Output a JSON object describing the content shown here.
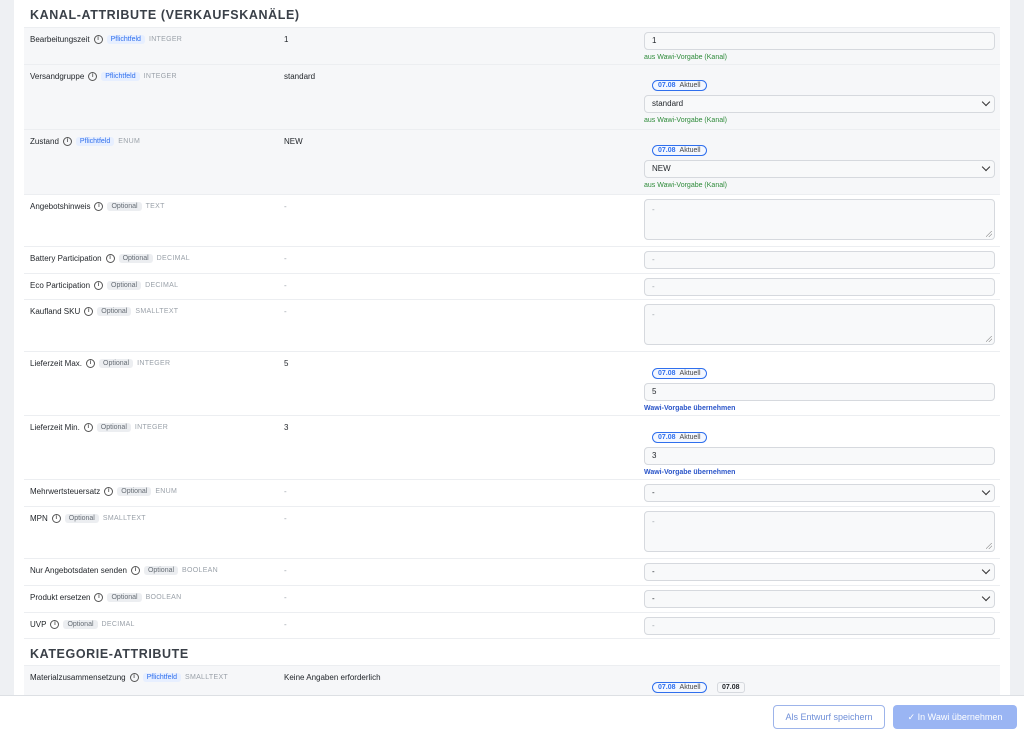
{
  "sections": {
    "kanal_title": "KANAL-ATTRIBUTE (VERKAUFSKANÄLE)",
    "kategorie_title": "KATEGORIE-ATTRIBUTE"
  },
  "badges": {
    "required": "Pflichtfeld",
    "optional": "Optional"
  },
  "version": {
    "number": "07.08",
    "current": "Aktuell",
    "plain": "07.08"
  },
  "hints": {
    "wawi_default_channel": "aus Wawi-Vorgabe (Kanal)",
    "apply_wawi_default": "Wawi-Vorgabe übernehmen"
  },
  "rows": [
    {
      "label": "Bearbeitungszeit",
      "badge": "Pflichtfeld",
      "type": "INTEGER",
      "value": "1",
      "input": "1",
      "hint": "aus Wawi-Vorgabe (Kanal)"
    },
    {
      "label": "Versandgruppe",
      "badge": "Pflichtfeld",
      "type": "INTEGER",
      "value": "standard",
      "select": "standard",
      "hint": "aus Wawi-Vorgabe (Kanal)"
    },
    {
      "label": "Zustand",
      "badge": "Pflichtfeld",
      "type": "ENUM",
      "value": "NEW",
      "select": "NEW",
      "hint": "aus Wawi-Vorgabe (Kanal)"
    },
    {
      "label": "Angebotshinweis",
      "badge": "Optional",
      "type": "TEXT",
      "value": "-",
      "textarea": "-"
    },
    {
      "label": "Battery Participation",
      "badge": "Optional",
      "type": "DECIMAL",
      "value": "-",
      "input": "-"
    },
    {
      "label": "Eco Participation",
      "badge": "Optional",
      "type": "DECIMAL",
      "value": "-",
      "input": "-"
    },
    {
      "label": "Kaufland SKU",
      "badge": "Optional",
      "type": "SMALLTEXT",
      "value": "-",
      "textarea": "-"
    },
    {
      "label": "Lieferzeit Max.",
      "badge": "Optional",
      "type": "INTEGER",
      "value": "5",
      "input": "5",
      "hint": "Wawi-Vorgabe übernehmen"
    },
    {
      "label": "Lieferzeit Min.",
      "badge": "Optional",
      "type": "INTEGER",
      "value": "3",
      "input": "3",
      "hint": "Wawi-Vorgabe übernehmen"
    },
    {
      "label": "Mehrwertsteuersatz",
      "badge": "Optional",
      "type": "ENUM",
      "value": "-",
      "select": "-"
    },
    {
      "label": "MPN",
      "badge": "Optional",
      "type": "SMALLTEXT",
      "value": "-",
      "textarea": "-"
    },
    {
      "label": "Nur Angebotsdaten senden",
      "badge": "Optional",
      "type": "BOOLEAN",
      "value": "-",
      "select": "-"
    },
    {
      "label": "Produkt ersetzen",
      "badge": "Optional",
      "type": "BOOLEAN",
      "value": "-",
      "select": "-"
    },
    {
      "label": "UVP",
      "badge": "Optional",
      "type": "DECIMAL",
      "value": "-",
      "input": "-"
    },
    {
      "label": "Materialzusammensetzung",
      "badge": "Pflichtfeld",
      "type": "SMALLTEXT",
      "value": "Keine Angaben erforderlich"
    }
  ],
  "footer": {
    "draft_button": "Als Entwurf speichern",
    "apply_button": "In Wawi übernehmen"
  },
  "colors": {
    "accent": "#2f6fed",
    "hint_green": "#2e8b3a",
    "apply_button_bg": "#9ab5f3"
  }
}
